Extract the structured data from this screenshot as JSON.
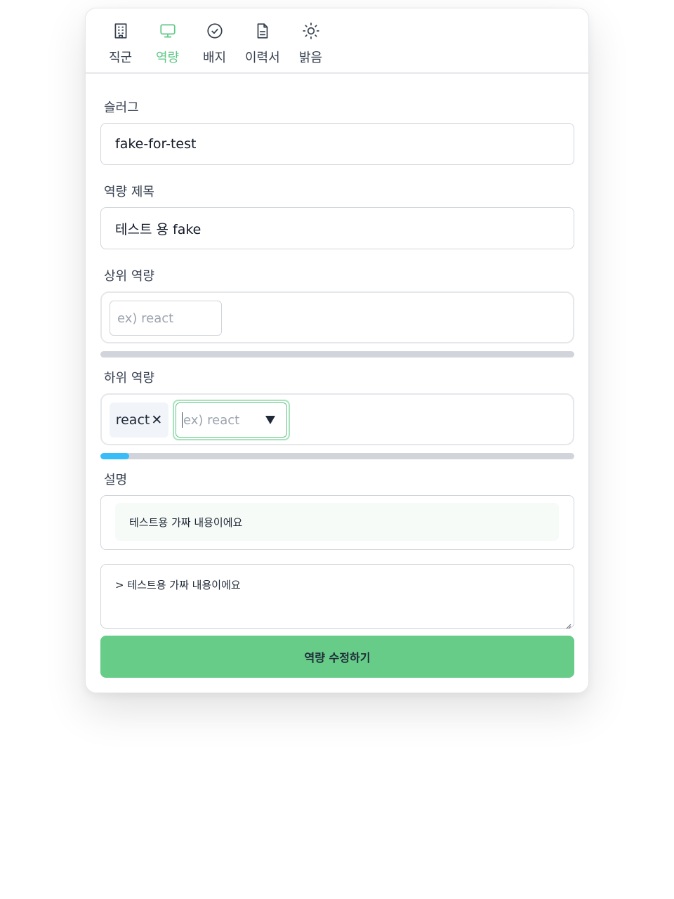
{
  "nav": {
    "items": [
      {
        "label": "직군",
        "icon": "building-icon",
        "active": false
      },
      {
        "label": "역량",
        "icon": "monitor-icon",
        "active": true
      },
      {
        "label": "배지",
        "icon": "badge-check-icon",
        "active": false
      },
      {
        "label": "이력서",
        "icon": "document-icon",
        "active": false
      },
      {
        "label": "밝음",
        "icon": "sun-icon",
        "active": false
      }
    ],
    "active_color": "#5fc887"
  },
  "form": {
    "slug": {
      "label": "슬러그",
      "value": "fake-for-test"
    },
    "title": {
      "label": "역량 제목",
      "value": "테스트 용 fake"
    },
    "parent": {
      "label": "상위 역량",
      "placeholder": "ex) react",
      "progress": 0
    },
    "children": {
      "label": "하위 역량",
      "tags": [
        {
          "text": "react",
          "remove": "✕"
        }
      ],
      "placeholder": "ex) react",
      "progress": 0.06,
      "progress_color": "#38bdf8"
    },
    "description": {
      "label": "설명",
      "preview": "테스트용 가짜 내용이에요",
      "markdown": "> 테스트용 가짜 내용이에요"
    },
    "submit_label": "역량 수정하기",
    "submit_color": "#66cc88"
  }
}
